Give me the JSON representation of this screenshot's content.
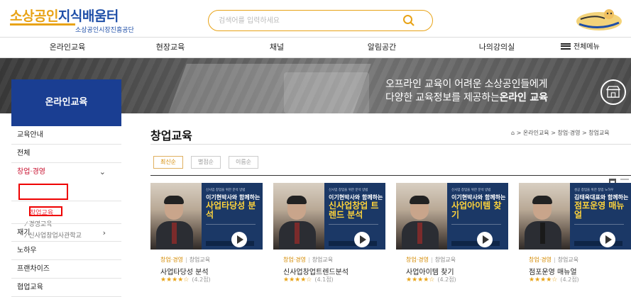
{
  "header": {
    "logo_part1": "소상공인",
    "logo_part2": "지식배움터",
    "logo_sub": "소상공인시장진흥공단",
    "search_placeholder": "검색어를 입력하세요"
  },
  "nav": {
    "items": [
      "온라인교육",
      "현장교육",
      "채널",
      "알림공간",
      "나의강의실"
    ],
    "all_menu": "전체메뉴"
  },
  "banner": {
    "line1": "오프라인 교육이 어려운 소상공인들에게",
    "line2_prefix": "다양한 교육정보를 제공하는",
    "line2_bold": "온라인 교육"
  },
  "sidebar": {
    "title": "온라인교육",
    "items": [
      "교육안내",
      "전체",
      "창업·경영",
      "재기",
      "노하우",
      "프랜차이즈",
      "협업교육"
    ],
    "sub_items": [
      "창업교육",
      "경영교육",
      "신사업창업사관학교"
    ]
  },
  "main": {
    "title": "창업교육",
    "breadcrumb": "⌂ > 온라인교육 > 창업·경영 > 창업교육",
    "sort_tabs": [
      "최신순",
      "별점순",
      "이름순"
    ]
  },
  "cards": [
    {
      "thumb_small": "신사업 창업을 위한 분석 방법",
      "thumb_name": "이기현박사와 함께하는",
      "thumb_big": "사업타당성 분석",
      "category": "창업·경영",
      "subcategory": "창업교육",
      "title": "사업타당성 분석",
      "stars": "★★★★☆",
      "score": "(4.2점)"
    },
    {
      "thumb_small": "신사업 창업을 위한 분석 방법",
      "thumb_name": "이기현박사와 함께하는",
      "thumb_big": "신사업창업 트렌드 분석",
      "category": "창업·경영",
      "subcategory": "창업교육",
      "title": "신사업창업트렌드분석",
      "stars": "★★★★☆",
      "score": "(4.1점)"
    },
    {
      "thumb_small": "신사업 창업을 위한 분석 방법",
      "thumb_name": "이기현박사와 함께하는",
      "thumb_big": "사업아이템 찾기",
      "category": "창업·경영",
      "subcategory": "창업교육",
      "title": "사업아이템 찾기",
      "stars": "★★★★☆",
      "score": "(4.2점)"
    },
    {
      "thumb_small": "성공 창업을 위한 창업 노하우",
      "thumb_name": "김태욱대표와 함께하는",
      "thumb_big": "점포운영 매뉴얼",
      "category": "창업·경영",
      "subcategory": "창업교육",
      "title": "점포운영 매뉴얼",
      "stars": "★★★★☆",
      "score": "(4.2점)"
    }
  ],
  "colors": {
    "brand_blue": "#1a3e92",
    "accent_orange": "#e8a317",
    "highlight_red": "#e00000"
  }
}
